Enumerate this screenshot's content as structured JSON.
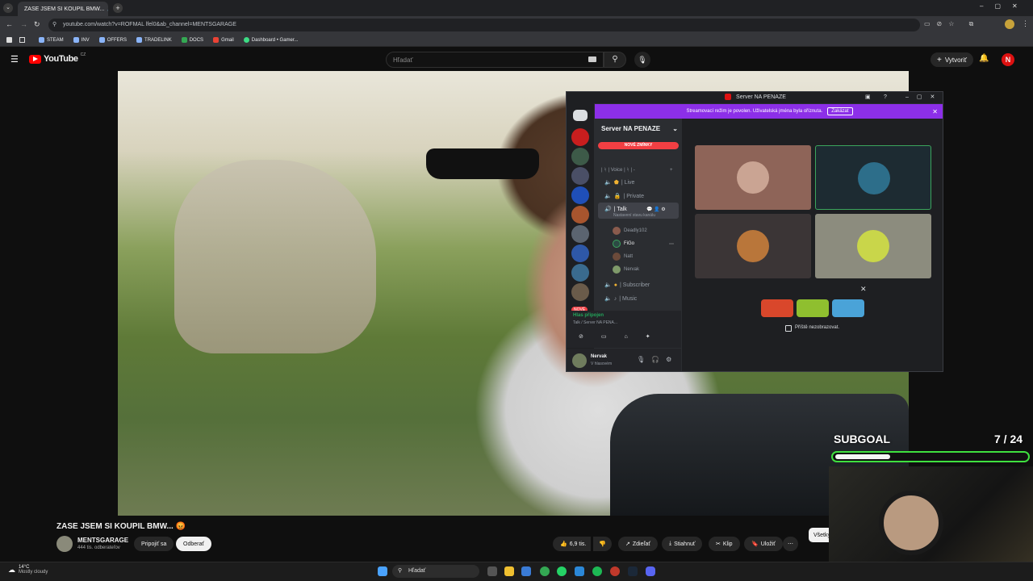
{
  "browser": {
    "tab_title": "ZASE JSEM SI KOUPIL BMW...",
    "url": "youtube.com/watch?v=ROFMAL lfel0&ab_channel=MENTSGARAGE",
    "bookmarks": [
      "STEAM",
      "INV",
      "OFFERS",
      "TRADELINK",
      "DOCS",
      "Gmail",
      "Dashboard • Gamer..."
    ]
  },
  "youtube": {
    "logo": "YouTube",
    "region": "CZ",
    "search_placeholder": "Hľadať",
    "create_label": "Vytvoriť",
    "avatar_letter": "N"
  },
  "video": {
    "title": "ZASE JSEM SI KOUPIL BMW... 😡",
    "channel": "MENTSGARAGE",
    "subscribers": "444 tis. odberateľov",
    "join_label": "Pripojiť sa",
    "subscribe_label": "Odberať",
    "likes": "6,9 tis.",
    "share_label": "Zdieľať",
    "download_label": "Stiahnuť",
    "clip_label": "Klip",
    "save_label": "Uložiť",
    "all_label": "Všetky"
  },
  "discord": {
    "window_title": "Server NA PENAZE",
    "stream_notice": "Streamovací režim je povolen. Uživatelská jména byla oříznuta.",
    "disable_label": "Zakázat",
    "server_name": "Server NA PENAZE",
    "new_mentions": "NOVÉ ZMÍNKY",
    "new_badge": "NOVÉ",
    "voice_category": "| ᛋ | Voice | ᛋ | -",
    "channels": {
      "live": "| Live",
      "private": "| Private",
      "talk": "| Talk",
      "talk_status": "Nastavení stavu kanálu",
      "subscriber": "| Subscriber",
      "music": "| Music"
    },
    "users": [
      "Deadly102",
      "FiGo",
      "Natt",
      "Nervak"
    ],
    "voice_connected": "Hlas připojen",
    "voice_location": "Talk / Server NA PENA...",
    "self_name": "Nervak",
    "self_status": "V hlasovém",
    "dont_show": "Příště nezobrazovat."
  },
  "overlay": {
    "subgoal_label": "SUBGOAL",
    "subgoal_count": "7 / 24",
    "subgoal_progress": 0.29
  },
  "taskbar": {
    "weather_temp": "14°C",
    "weather_desc": "Mostly cloudy",
    "search_label": "Hľadať"
  },
  "colors": {
    "youtube_red": "#ff0000",
    "discord_purple": "#8c2fe8",
    "subgoal_green": "#3fe03f"
  }
}
